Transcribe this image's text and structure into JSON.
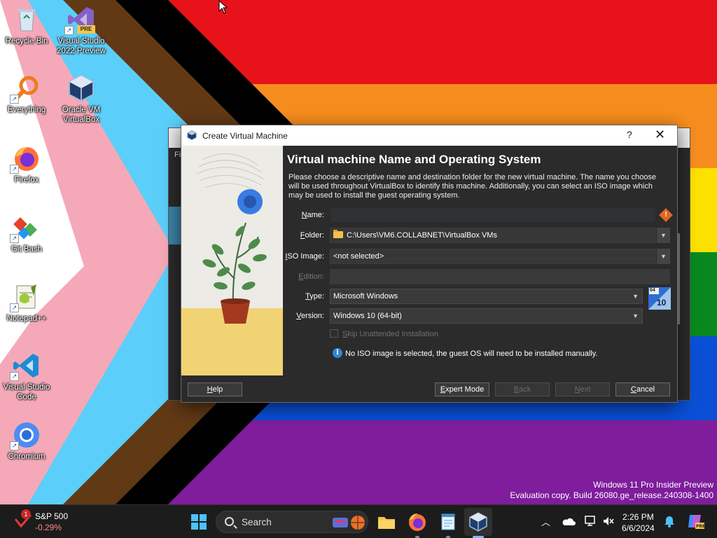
{
  "desktop": {
    "icons": [
      {
        "label": "Recycle Bin",
        "icon": "recycle-bin-icon"
      },
      {
        "label": "Visual Studio 2022 Preview",
        "icon": "visual-studio-icon",
        "badge": "PRE"
      },
      {
        "label": "Everything",
        "icon": "everything-search-icon"
      },
      {
        "label": "Oracle VM VirtualBox",
        "icon": "virtualbox-icon"
      },
      {
        "label": "Firefox",
        "icon": "firefox-icon"
      },
      {
        "label": "Git Bash",
        "icon": "git-bash-icon"
      },
      {
        "label": "Notepad++",
        "icon": "notepad-plus-plus-icon"
      },
      {
        "label": "Visual Studio Code",
        "icon": "vscode-icon"
      },
      {
        "label": "Chromium",
        "icon": "chromium-icon"
      }
    ]
  },
  "dialog": {
    "title": "Create Virtual Machine",
    "help_glyph": "?",
    "close_glyph": "✕",
    "heading": "Virtual machine Name and Operating System",
    "description": "Please choose a descriptive name and destination folder for the new virtual machine. The name you choose will be used throughout VirtualBox to identify this machine. Additionally, you can select an ISO image which may be used to install the guest operating system.",
    "fields": {
      "name": {
        "label_key": "N",
        "label_rest": "ame:",
        "value": ""
      },
      "folder": {
        "label_key": "F",
        "label_rest": "older:",
        "value": "C:\\Users\\VM6.COLLABNET\\VirtualBox VMs"
      },
      "iso": {
        "label_key": "I",
        "label_rest": "SO Image:",
        "value": "<not selected>"
      },
      "edition": {
        "label_key": "E",
        "label_rest": "dition:",
        "value": ""
      },
      "type": {
        "label_key": "T",
        "label_rest": "ype:",
        "value": "Microsoft Windows"
      },
      "version": {
        "label_key": "V",
        "label_rest": "ersion:",
        "value": "Windows 10 (64-bit)"
      }
    },
    "skip_unattended": {
      "label_key": "S",
      "label_rest": "kip Unattended Installation",
      "checked": false
    },
    "info_message": "No ISO image is selected, the guest OS will need to be installed manually.",
    "buttons": {
      "help": {
        "key": "H",
        "rest": "elp"
      },
      "expert": {
        "key": "E",
        "rest": "xpert Mode"
      },
      "back": {
        "key": "B",
        "rest": "ack"
      },
      "next": {
        "key": "N",
        "rest": "ext"
      },
      "cancel": {
        "key": "C",
        "rest": "ancel"
      }
    },
    "os_logo": {
      "bits": "64",
      "version": "10"
    }
  },
  "background_window": {
    "menu_fragment": "Fi"
  },
  "watermark": {
    "line1": "Windows 11 Pro Insider Preview",
    "line2": "Evaluation copy. Build 26080.ge_release.240308-1400"
  },
  "taskbar": {
    "stock": {
      "name": "S&P 500",
      "change": "-0.29%",
      "alert_count": "1"
    },
    "search_label": "Search",
    "clock": {
      "time": "2:26 PM",
      "date": "6/6/2024"
    },
    "colors": {
      "accent": "#8ab4f8",
      "background": "#1c1c1c"
    }
  }
}
